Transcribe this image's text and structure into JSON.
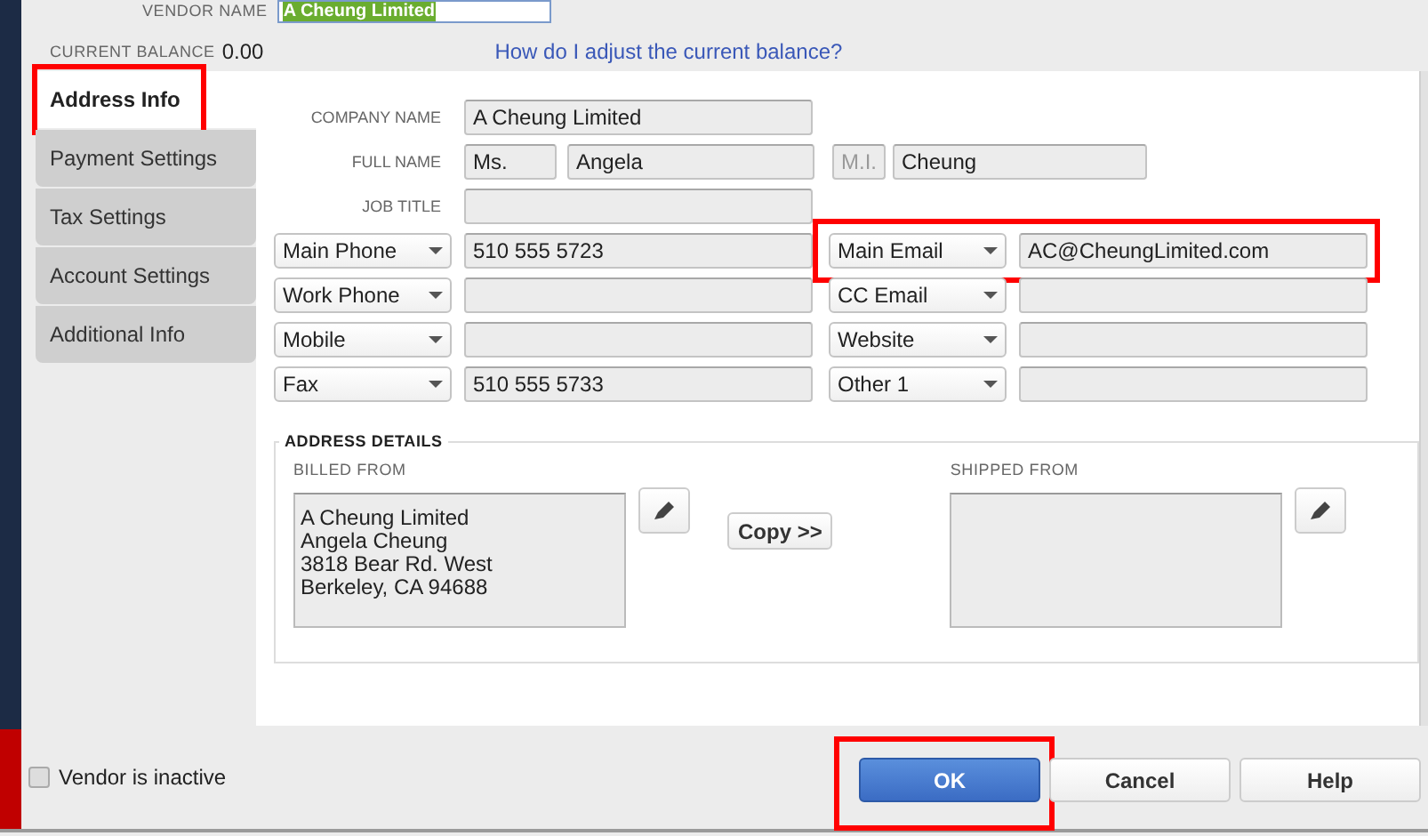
{
  "vendor_name": {
    "label": "VENDOR NAME",
    "value": "A Cheung Limited"
  },
  "current_balance": {
    "label": "CURRENT BALANCE",
    "value": "0.00"
  },
  "help_link": "How do I adjust the current balance?",
  "tabs": [
    {
      "label": "Address Info",
      "selected": true,
      "highlighted": true
    },
    {
      "label": "Payment Settings",
      "selected": false,
      "highlighted": false
    },
    {
      "label": "Tax Settings",
      "selected": false,
      "highlighted": false
    },
    {
      "label": "Account Settings",
      "selected": false,
      "highlighted": false
    },
    {
      "label": "Additional Info",
      "selected": false,
      "highlighted": false
    }
  ],
  "company_name": {
    "label": "COMPANY NAME",
    "value": "A Cheung Limited"
  },
  "full_name": {
    "label": "FULL NAME",
    "title": "Ms.",
    "first": "Angela",
    "mi_placeholder": "M.I.",
    "last": "Cheung"
  },
  "job_title": {
    "label": "JOB TITLE"
  },
  "contacts": [
    {
      "left": {
        "type": "Main Phone",
        "value": "510 555 5723"
      },
      "right": {
        "type": "Main Email",
        "value": "AC@CheungLimited.com"
      },
      "highlighted": true
    },
    {
      "left": {
        "type": "Work Phone"
      },
      "right": {
        "type": "CC Email"
      },
      "highlighted": false
    },
    {
      "left": {
        "type": "Mobile"
      },
      "right": {
        "type": "Website"
      },
      "highlighted": false
    },
    {
      "left": {
        "type": "Fax",
        "value": "510 555 5733"
      },
      "right": {
        "type": "Other 1"
      },
      "highlighted": false
    }
  ],
  "address_details": {
    "title": "ADDRESS DETAILS",
    "billed_from": {
      "label": "BILLED FROM",
      "lines": [
        "A Cheung Limited",
        "Angela Cheung",
        "3818 Bear Rd. West",
        "Berkeley, CA 94688"
      ]
    },
    "copy_button": "Copy >>",
    "shipped_from": {
      "label": "SHIPPED FROM"
    }
  },
  "vendor_inactive": {
    "label": "Vendor is inactive",
    "checked": false
  },
  "buttons": [
    {
      "label": "OK",
      "kind": "primary",
      "highlighted": true
    },
    {
      "label": "Cancel",
      "kind": "normal",
      "highlighted": false
    },
    {
      "label": "Help",
      "kind": "normal",
      "highlighted": false
    }
  ]
}
